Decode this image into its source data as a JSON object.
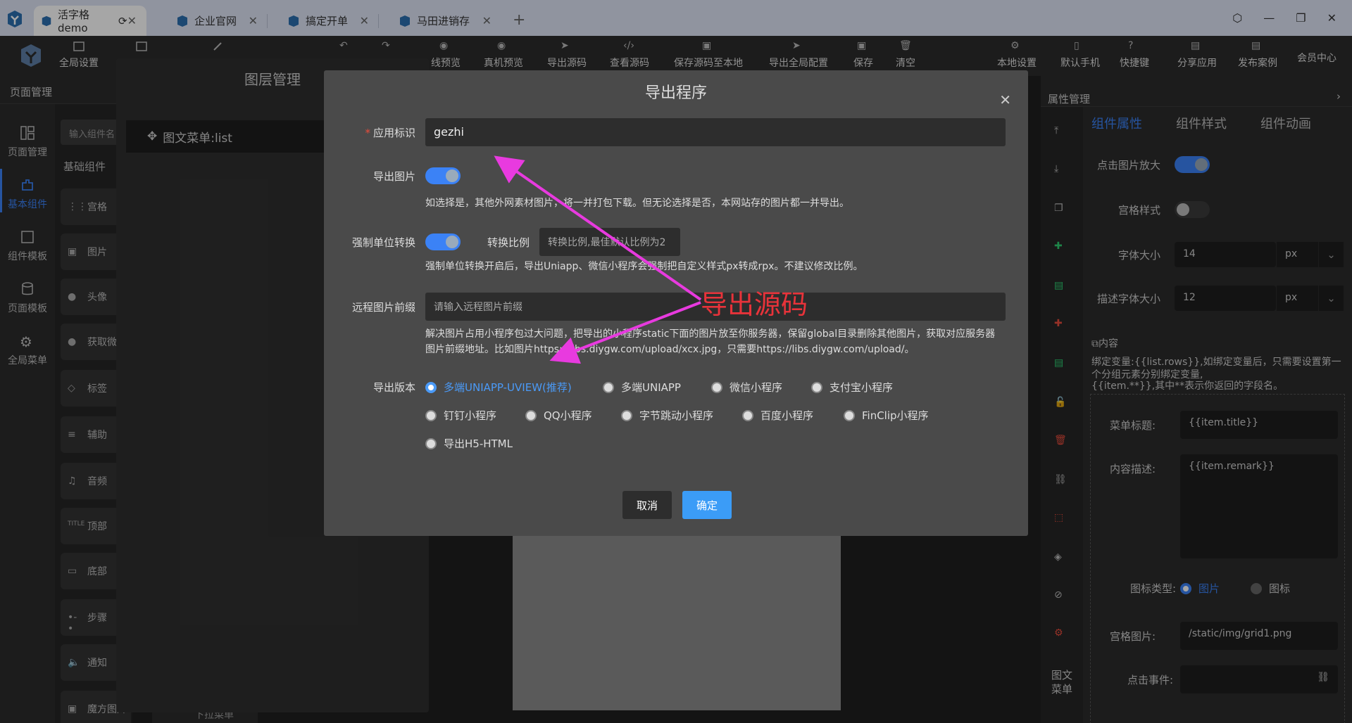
{
  "browser": {
    "tabs": [
      {
        "label": "活字格demo",
        "active": true
      },
      {
        "label": "企业官网"
      },
      {
        "label": "搞定开单"
      },
      {
        "label": "马田进销存"
      }
    ],
    "new_tab": "+"
  },
  "toolbar": {
    "items": [
      "全局设置",
      "线预览",
      "真机预览",
      "导出源码",
      "查看源码",
      "保存源码至本地",
      "导出全局配置",
      "保存",
      "清空",
      "本地设置",
      "默认手机",
      "快捷键",
      "分享应用",
      "发布案例"
    ],
    "member_center": "会员中心"
  },
  "left_nav": {
    "header": "页面管理",
    "items": [
      "页面管理",
      "基本组件",
      "组件模板",
      "页面模板",
      "全局菜单"
    ],
    "active": "基本组件"
  },
  "components": {
    "search_placeholder": "输入组件名",
    "section_label": "基础组件",
    "cards": [
      "宫格",
      "图片",
      "头像",
      "获取微",
      "标签",
      "辅助",
      "音频",
      "顶部",
      "底部",
      "步骤",
      "通知",
      "魔方图片"
    ],
    "bottom_card": "下拉菜单"
  },
  "layer_panel": {
    "title": "图层管理",
    "row": "图文菜单:list"
  },
  "right_panel": {
    "header": "属性管理",
    "tabs": [
      "组件属性",
      "组件样式",
      "组件动画"
    ],
    "active_tab": "组件属性",
    "click_zoom_label": "点击图片放大",
    "click_zoom_on": true,
    "grid_style_label": "宫格样式",
    "grid_style_on": false,
    "font_size_label": "字体大小",
    "font_size_value": "14",
    "font_size_unit": "px",
    "desc_font_size_label": "描述字体大小",
    "desc_font_size_value": "12",
    "desc_font_size_unit": "px",
    "content_section": "内容",
    "bind_note": "绑定变量:{{list.rows}},如绑定变量后，只需要设置第一个分组元素分别绑定变量,",
    "bind_note2": "{{item.**}},其中**表示你返回的字段名。",
    "menu_title_label": "菜单标题:",
    "menu_title_value": "{{item.title}}",
    "content_desc_label": "内容描述:",
    "content_desc_value": "{{item.remark}}",
    "icon_type_label": "图标类型:",
    "icon_type_options": [
      "图片",
      "图标"
    ],
    "icon_type_selected": "图片",
    "grid_image_label": "宫格图片:",
    "grid_image_value": "/static/img/grid1.png",
    "click_event_label": "点击事件:",
    "side_label_1": "图文",
    "side_label_2": "菜单"
  },
  "modal": {
    "title": "导出程序",
    "app_id_label": "应用标识",
    "app_id_value": "gezhi",
    "export_images_label": "导出图片",
    "export_images_on": true,
    "export_images_help": "如选择是，其他外网素材图片，将一并打包下载。但无论选择是否，本网站存的图片都一并导出。",
    "force_unit_label": "强制单位转换",
    "force_unit_on": true,
    "ratio_label": "转换比例",
    "ratio_placeholder": "转换比例,最佳默认比例为2",
    "force_unit_help": "强制单位转换开启后，导出Uniapp、微信小程序会强制把自定义样式px转成rpx。不建议修改比例。",
    "remote_prefix_label": "远程图片前缀",
    "remote_prefix_placeholder": "请输入远程图片前缀",
    "remote_prefix_help": "解决图片占用小程序包过大问题，把导出的小程序static下面的图片放至你服务器，保留global目录删除其他图片，获取对应服务器图片前缀地址。比如图片https://libs.diygw.com/upload/xcx.jpg，只需要https://libs.diygw.com/upload/。",
    "version_label": "导出版本",
    "versions": [
      "多端UNIAPP-UVIEW(推荐)",
      "多端UNIAPP",
      "微信小程序",
      "支付宝小程序",
      "钉钉小程序",
      "QQ小程序",
      "字节跳动小程序",
      "百度小程序",
      "FinClip小程序",
      "导出H5-HTML"
    ],
    "selected_version": "多端UNIAPP-UVIEW(推荐)",
    "cancel": "取消",
    "ok": "确定"
  },
  "annotation": {
    "text": "导出源码",
    "color": "#e8333a",
    "arrow_color": "#e83adf"
  }
}
